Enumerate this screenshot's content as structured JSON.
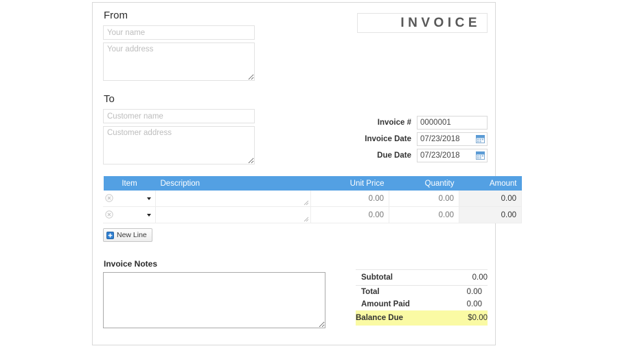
{
  "document": {
    "title": "INVOICE"
  },
  "from": {
    "label": "From",
    "name_placeholder": "Your name",
    "name_value": "",
    "address_placeholder": "Your address",
    "address_value": ""
  },
  "to": {
    "label": "To",
    "name_placeholder": "Customer name",
    "name_value": "",
    "address_placeholder": "Customer address",
    "address_value": ""
  },
  "meta": {
    "invoice_number_label": "Invoice #",
    "invoice_number_value": "0000001",
    "invoice_date_label": "Invoice Date",
    "invoice_date_value": "07/23/2018",
    "due_date_label": "Due Date",
    "due_date_value": "07/23/2018"
  },
  "items_table": {
    "headers": {
      "item": "Item",
      "description": "Description",
      "unit_price": "Unit Price",
      "quantity": "Quantity",
      "amount": "Amount"
    },
    "rows": [
      {
        "item_value": "",
        "description_value": "",
        "description_placeholder": "",
        "unit_price_placeholder": "0.00",
        "unit_price_value": "",
        "quantity_placeholder": "0.00",
        "quantity_value": "",
        "amount": "0.00"
      },
      {
        "item_value": "",
        "description_value": "",
        "description_placeholder": "",
        "unit_price_placeholder": "0.00",
        "unit_price_value": "",
        "quantity_placeholder": "0.00",
        "quantity_value": "",
        "amount": "0.00"
      }
    ],
    "new_line_label": "New Line"
  },
  "notes": {
    "label": "Invoice Notes",
    "value": "",
    "placeholder": ""
  },
  "totals": {
    "subtotal_label": "Subtotal",
    "subtotal_value": "0.00",
    "total_label": "Total",
    "total_value": "0.00",
    "amount_paid_label": "Amount Paid",
    "amount_paid_value": "0.00",
    "balance_due_label": "Balance Due",
    "balance_due_value": "$0.00"
  },
  "colors": {
    "table_header_blue": "#53a0e3",
    "balance_highlight_yellow": "#fafaa4",
    "amount_cell_gray": "#f3f3f3",
    "frame_border": "#d8d8d8"
  }
}
